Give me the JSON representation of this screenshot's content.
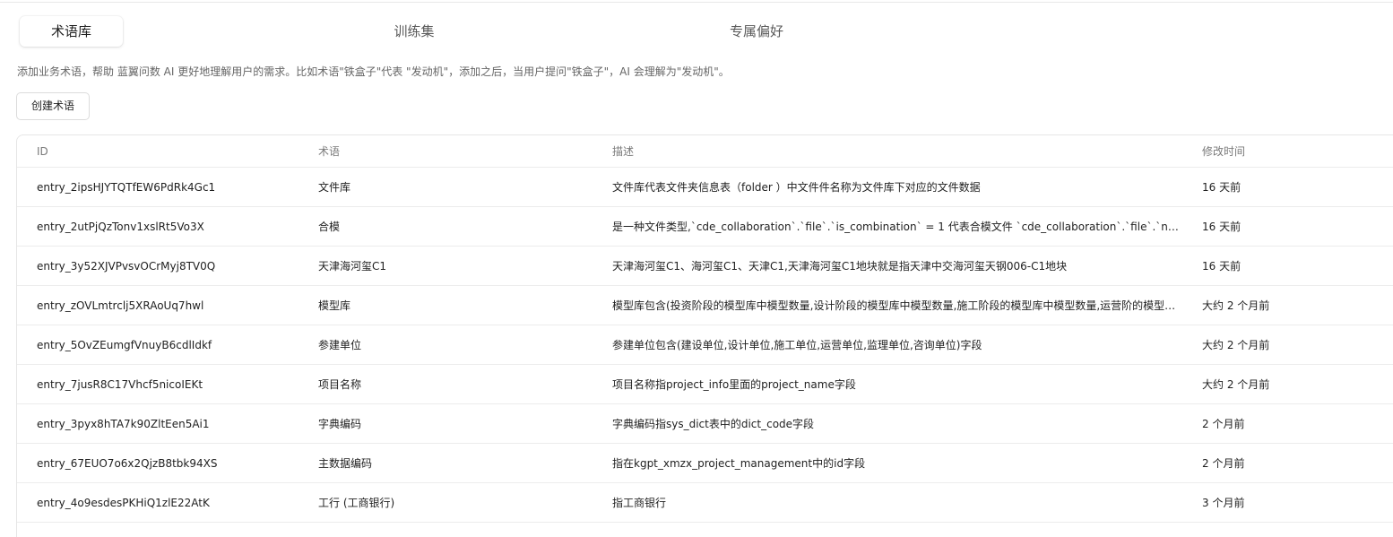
{
  "tabs": [
    {
      "label": "术语库",
      "active": true
    },
    {
      "label": "训练集",
      "active": false
    },
    {
      "label": "专属偏好",
      "active": false
    }
  ],
  "description": "添加业务术语，帮助 蓝翼问数 AI 更好地理解用户的需求。比如术语\"铁盒子\"代表 \"发动机\"，添加之后，当用户提问\"铁盒子\"，AI 会理解为\"发动机\"。",
  "create_button": "创建术语",
  "table": {
    "columns": {
      "id": "ID",
      "term": "术语",
      "desc": "描述",
      "time": "修改时间"
    },
    "rows": [
      {
        "id": "entry_2ipsHJYTQTfEW6PdRk4Gc1",
        "term": "文件库",
        "desc": "文件库代表文件夹信息表（folder ）中文件件名称为文件库下对应的文件数据",
        "time": "16 天前"
      },
      {
        "id": "entry_2utPjQzTonv1xslRt5Vo3X",
        "term": "合模",
        "desc": "是一种文件类型,`cde_collaboration`.`file`.`is_combination` = 1 代表合模文件 `cde_collaboration`.`file`.`name` 则代表合模文件名称",
        "time": "16 天前"
      },
      {
        "id": "entry_3y52XJVPvsvOCrMyj8TV0Q",
        "term": "天津海河玺C1",
        "desc": "天津海河玺C1、海河玺C1、天津C1,天津海河玺C1地块就是指天津中交海河玺天钢006-C1地块",
        "time": "16 天前"
      },
      {
        "id": "entry_zOVLmtrclj5XRAoUq7hwl",
        "term": "模型库",
        "desc": "模型库包含(投资阶段的模型库中模型数量,设计阶段的模型库中模型数量,施工阶段的模型库中模型数量,运营阶的模型库中模型数量)",
        "time": "大约 2 个月前"
      },
      {
        "id": "entry_5OvZEumgfVnuyB6cdlIdkf",
        "term": "参建单位",
        "desc": "参建单位包含(建设单位,设计单位,施工单位,运营单位,监理单位,咨询单位)字段",
        "time": "大约 2 个月前"
      },
      {
        "id": "entry_7jusR8C17Vhcf5nicoIEKt",
        "term": "项目名称",
        "desc": "项目名称指project_info里面的project_name字段",
        "time": "大约 2 个月前"
      },
      {
        "id": "entry_3pyx8hTA7k90ZltEen5Ai1",
        "term": "字典编码",
        "desc": "字典编码指sys_dict表中的dict_code字段",
        "time": "2 个月前"
      },
      {
        "id": "entry_67EUO7o6x2QjzB8tbk94XS",
        "term": "主数据编码",
        "desc": "指在kgpt_xmzx_project_management中的id字段",
        "time": "2 个月前"
      },
      {
        "id": "entry_4o9esdesPKHiQ1zlE22AtK",
        "term": "工行 (工商银行)",
        "desc": "指工商银行",
        "time": "3 个月前"
      }
    ]
  }
}
